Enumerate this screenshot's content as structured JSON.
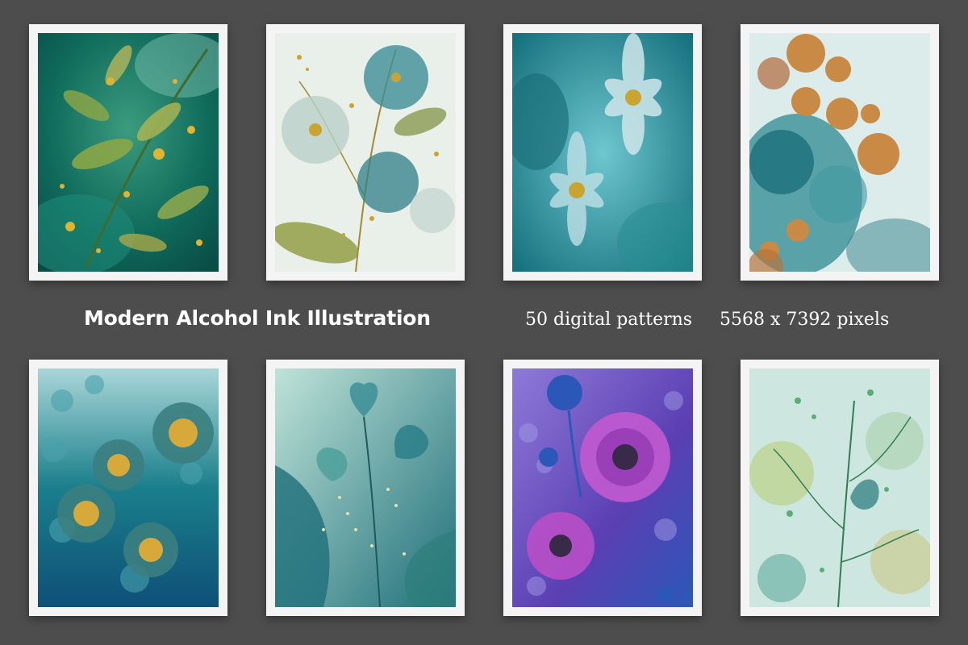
{
  "headline": {
    "title": "Modern Alcohol Ink Illustration",
    "count": "50 digital patterns",
    "size": "5568 x 7392 pixels"
  },
  "gallery": [
    {
      "name": "art-green-leaves-gold-dots",
      "colors": [
        "#0f6a5a",
        "#2f8f74",
        "#c9a431"
      ]
    },
    {
      "name": "art-teal-flowers-gold-branches",
      "colors": [
        "#e9efe9",
        "#3f8f97",
        "#b8992e"
      ]
    },
    {
      "name": "art-turquoise-bloom",
      "colors": [
        "#1f8f98",
        "#6ec7cf",
        "#c9a431"
      ]
    },
    {
      "name": "art-copper-gold-circles",
      "colors": [
        "#2c8a92",
        "#c98a46",
        "#dcecea"
      ]
    },
    {
      "name": "art-teal-gold-flowers",
      "colors": [
        "#1a7f8b",
        "#0f4f78",
        "#c9a431"
      ]
    },
    {
      "name": "art-teal-ginkgo-leaves",
      "colors": [
        "#7fc7bd",
        "#1e6f7a",
        "#d9c98a"
      ]
    },
    {
      "name": "art-purple-blue-flowers",
      "colors": [
        "#5b3fb3",
        "#b43fc5",
        "#2b58b8"
      ]
    },
    {
      "name": "art-green-botanical-branches",
      "colors": [
        "#cde7e0",
        "#2f8f5e",
        "#c9b341"
      ]
    }
  ]
}
